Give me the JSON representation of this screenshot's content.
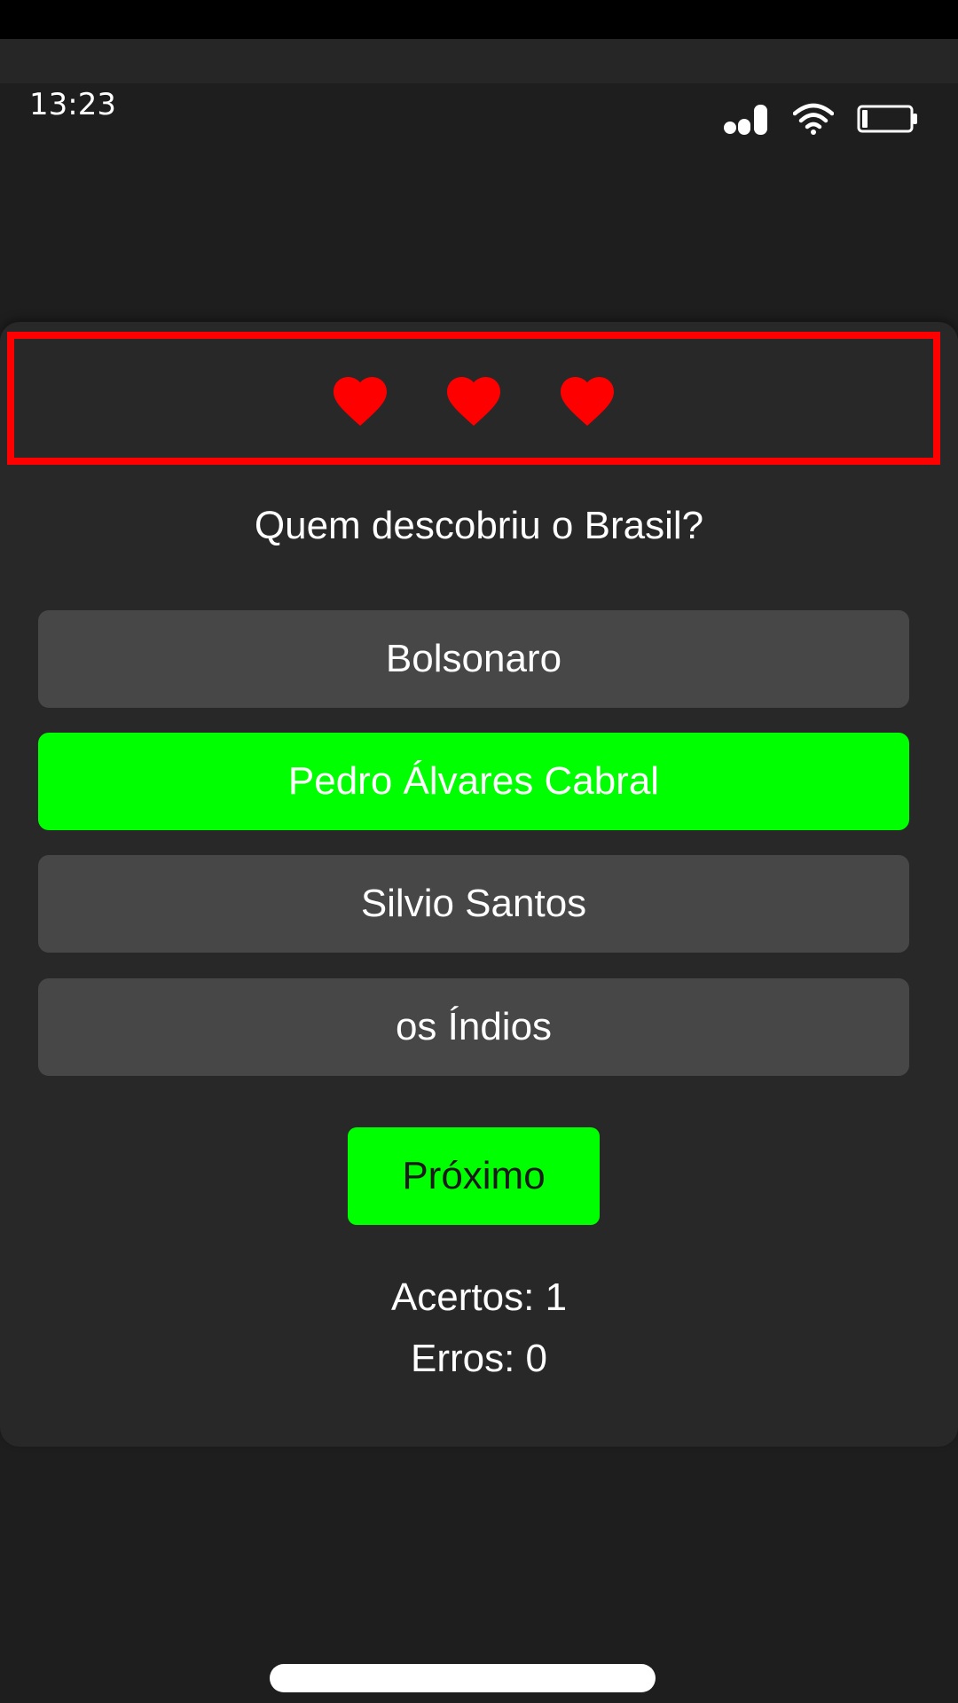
{
  "status_bar": {
    "time": "13:23",
    "icons": [
      "signal-icon",
      "wifi-icon",
      "battery-icon"
    ]
  },
  "lives": {
    "count": 3,
    "icon": "heart-icon",
    "color": "#ff0000"
  },
  "quiz": {
    "question": "Quem descobriu o Brasil?",
    "answers": [
      {
        "label": "Bolsonaro",
        "state": "default"
      },
      {
        "label": "Pedro Álvares Cabral",
        "state": "correct"
      },
      {
        "label": "Silvio Santos",
        "state": "default"
      },
      {
        "label": "os Índios",
        "state": "default"
      }
    ],
    "next_label": "Próximo"
  },
  "score": {
    "hits": "Acertos: 1",
    "errors": "Erros: 0"
  },
  "colors": {
    "correct": "#00ff00",
    "answer_default": "#474747",
    "card_background": "#282828",
    "page_background": "#1e1e1e",
    "lives_border": "#ff0000"
  }
}
